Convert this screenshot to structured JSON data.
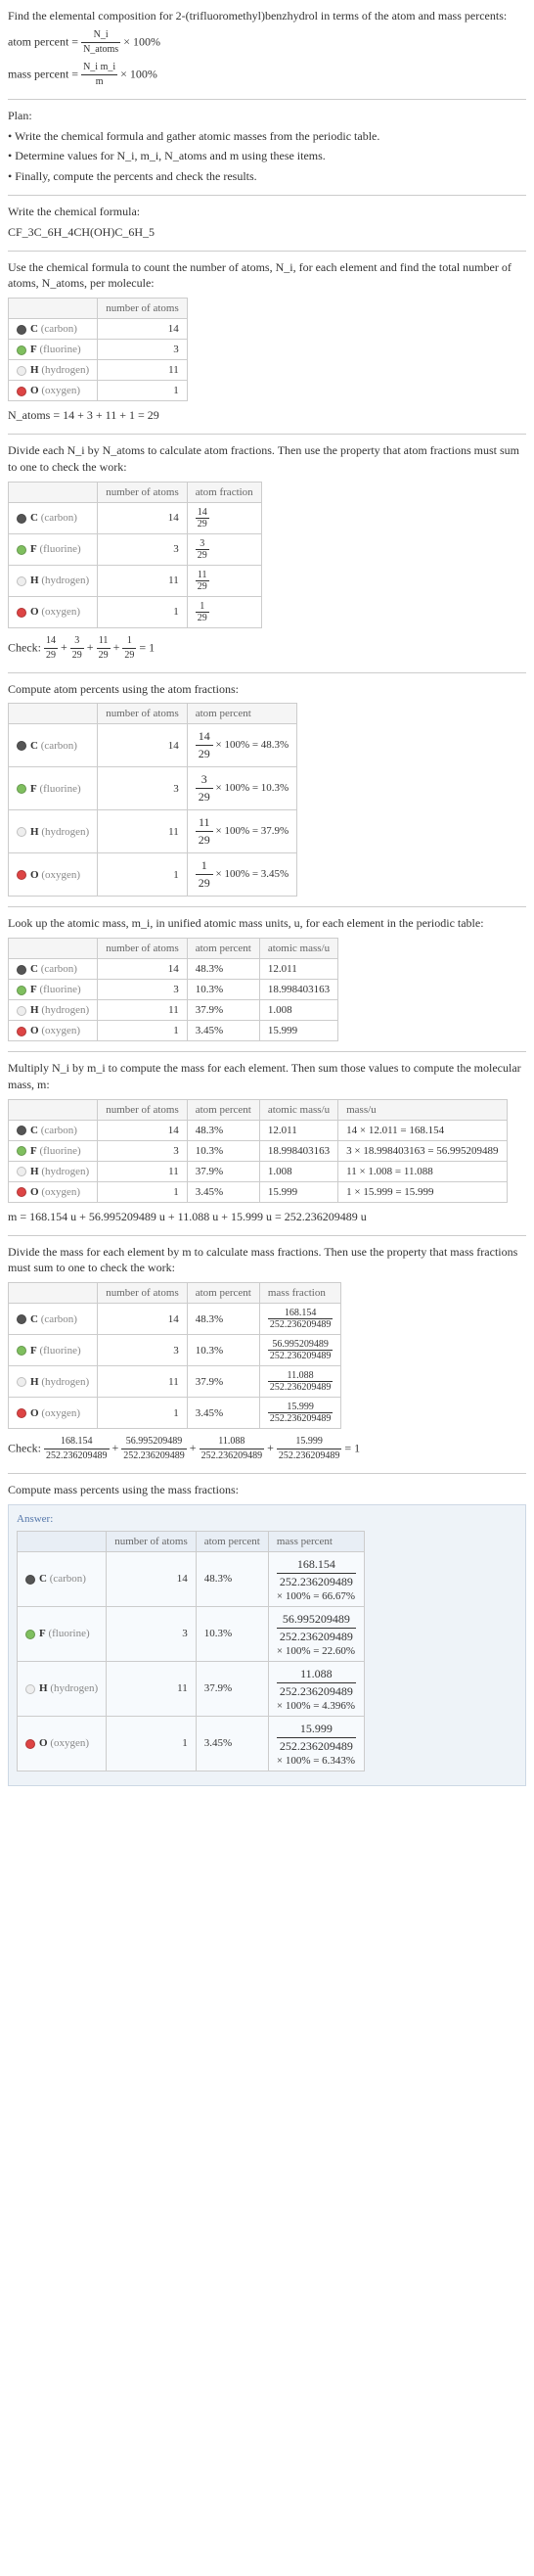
{
  "intro": {
    "line1": "Find the elemental composition for 2-(trifluoromethyl)benzhydrol in terms of the atom and mass percents:",
    "atom_eq_lhs": "atom percent =",
    "atom_eq_num": "N_i",
    "atom_eq_den": "N_atoms",
    "times100": "× 100%",
    "mass_eq_lhs": "mass percent =",
    "mass_eq_num": "N_i m_i",
    "mass_eq_den": "m"
  },
  "plan": {
    "title": "Plan:",
    "b1": "• Write the chemical formula and gather atomic masses from the periodic table.",
    "b2": "• Determine values for N_i, m_i, N_atoms and m using these items.",
    "b3": "• Finally, compute the percents and check the results."
  },
  "chem_formula": {
    "title": "Write the chemical formula:",
    "formula": "CF_3C_6H_4CH(OH)C_6H_5"
  },
  "count_atoms": {
    "title": "Use the chemical formula to count the number of atoms, N_i, for each element and find the total number of atoms, N_atoms, per molecule:",
    "headers": [
      "",
      "number of atoms"
    ],
    "rows": [
      {
        "dot": "dot-c",
        "sym": "C",
        "name": "(carbon)",
        "n": "14"
      },
      {
        "dot": "dot-f",
        "sym": "F",
        "name": "(fluorine)",
        "n": "3"
      },
      {
        "dot": "dot-h",
        "sym": "H",
        "name": "(hydrogen)",
        "n": "11"
      },
      {
        "dot": "dot-o",
        "sym": "O",
        "name": "(oxygen)",
        "n": "1"
      }
    ],
    "sum": "N_atoms = 14 + 3 + 11 + 1 = 29"
  },
  "atom_fractions": {
    "title": "Divide each N_i by N_atoms to calculate atom fractions. Then use the property that atom fractions must sum to one to check the work:",
    "headers": [
      "",
      "number of atoms",
      "atom fraction"
    ],
    "rows": [
      {
        "dot": "dot-c",
        "sym": "C",
        "name": "(carbon)",
        "n": "14",
        "fnum": "14",
        "fden": "29"
      },
      {
        "dot": "dot-f",
        "sym": "F",
        "name": "(fluorine)",
        "n": "3",
        "fnum": "3",
        "fden": "29"
      },
      {
        "dot": "dot-h",
        "sym": "H",
        "name": "(hydrogen)",
        "n": "11",
        "fnum": "11",
        "fden": "29"
      },
      {
        "dot": "dot-o",
        "sym": "O",
        "name": "(oxygen)",
        "n": "1",
        "fnum": "1",
        "fden": "29"
      }
    ],
    "check_prefix": "Check:",
    "check_eq": " + ",
    "check_eqend": " = 1"
  },
  "atom_percents": {
    "title": "Compute atom percents using the atom fractions:",
    "headers": [
      "",
      "number of atoms",
      "atom percent"
    ],
    "rows": [
      {
        "dot": "dot-c",
        "sym": "C",
        "name": "(carbon)",
        "n": "14",
        "fnum": "14",
        "fden": "29",
        "pct": "× 100% = 48.3%"
      },
      {
        "dot": "dot-f",
        "sym": "F",
        "name": "(fluorine)",
        "n": "3",
        "fnum": "3",
        "fden": "29",
        "pct": "× 100% = 10.3%"
      },
      {
        "dot": "dot-h",
        "sym": "H",
        "name": "(hydrogen)",
        "n": "11",
        "fnum": "11",
        "fden": "29",
        "pct": "× 100% = 37.9%"
      },
      {
        "dot": "dot-o",
        "sym": "O",
        "name": "(oxygen)",
        "n": "1",
        "fnum": "1",
        "fden": "29",
        "pct": "× 100% = 3.45%"
      }
    ]
  },
  "atomic_mass": {
    "title": "Look up the atomic mass, m_i, in unified atomic mass units, u, for each element in the periodic table:",
    "headers": [
      "",
      "number of atoms",
      "atom percent",
      "atomic mass/u"
    ],
    "rows": [
      {
        "dot": "dot-c",
        "sym": "C",
        "name": "(carbon)",
        "n": "14",
        "pct": "48.3%",
        "mass": "12.011"
      },
      {
        "dot": "dot-f",
        "sym": "F",
        "name": "(fluorine)",
        "n": "3",
        "pct": "10.3%",
        "mass": "18.998403163"
      },
      {
        "dot": "dot-h",
        "sym": "H",
        "name": "(hydrogen)",
        "n": "11",
        "pct": "37.9%",
        "mass": "1.008"
      },
      {
        "dot": "dot-o",
        "sym": "O",
        "name": "(oxygen)",
        "n": "1",
        "pct": "3.45%",
        "mass": "15.999"
      }
    ]
  },
  "molecular_mass": {
    "title": "Multiply N_i by m_i to compute the mass for each element. Then sum those values to compute the molecular mass, m:",
    "headers": [
      "",
      "number of atoms",
      "atom percent",
      "atomic mass/u",
      "mass/u"
    ],
    "rows": [
      {
        "dot": "dot-c",
        "sym": "C",
        "name": "(carbon)",
        "n": "14",
        "pct": "48.3%",
        "mass": "12.011",
        "calc": "14 × 12.011 = 168.154"
      },
      {
        "dot": "dot-f",
        "sym": "F",
        "name": "(fluorine)",
        "n": "3",
        "pct": "10.3%",
        "mass": "18.998403163",
        "calc": "3 × 18.998403163 = 56.995209489"
      },
      {
        "dot": "dot-h",
        "sym": "H",
        "name": "(hydrogen)",
        "n": "11",
        "pct": "37.9%",
        "mass": "1.008",
        "calc": "11 × 1.008 = 11.088"
      },
      {
        "dot": "dot-o",
        "sym": "O",
        "name": "(oxygen)",
        "n": "1",
        "pct": "3.45%",
        "mass": "15.999",
        "calc": "1 × 15.999 = 15.999"
      }
    ],
    "sum": "m = 168.154 u + 56.995209489 u + 11.088 u + 15.999 u = 252.236209489 u"
  },
  "mass_fractions": {
    "title": "Divide the mass for each element by m to calculate mass fractions. Then use the property that mass fractions must sum to one to check the work:",
    "headers": [
      "",
      "number of atoms",
      "atom percent",
      "mass fraction"
    ],
    "rows": [
      {
        "dot": "dot-c",
        "sym": "C",
        "name": "(carbon)",
        "n": "14",
        "pct": "48.3%",
        "fnum": "168.154",
        "fden": "252.236209489"
      },
      {
        "dot": "dot-f",
        "sym": "F",
        "name": "(fluorine)",
        "n": "3",
        "pct": "10.3%",
        "fnum": "56.995209489",
        "fden": "252.236209489"
      },
      {
        "dot": "dot-h",
        "sym": "H",
        "name": "(hydrogen)",
        "n": "11",
        "pct": "37.9%",
        "fnum": "11.088",
        "fden": "252.236209489"
      },
      {
        "dot": "dot-o",
        "sym": "O",
        "name": "(oxygen)",
        "n": "1",
        "pct": "3.45%",
        "fnum": "15.999",
        "fden": "252.236209489"
      }
    ],
    "check_prefix": "Check:",
    "check_nums": [
      "168.154",
      "56.995209489",
      "11.088",
      "15.999"
    ],
    "check_den": "252.236209489",
    "check_end": " = 1"
  },
  "mass_percents_title": "Compute mass percents using the mass fractions:",
  "answer": {
    "label": "Answer:",
    "headers": [
      "",
      "number of atoms",
      "atom percent",
      "mass percent"
    ],
    "rows": [
      {
        "dot": "dot-c",
        "sym": "C",
        "name": "(carbon)",
        "n": "14",
        "pct": "48.3%",
        "fnum": "168.154",
        "fden": "252.236209489",
        "res": "× 100% = 66.67%"
      },
      {
        "dot": "dot-f",
        "sym": "F",
        "name": "(fluorine)",
        "n": "3",
        "pct": "10.3%",
        "fnum": "56.995209489",
        "fden": "252.236209489",
        "res": "× 100% = 22.60%"
      },
      {
        "dot": "dot-h",
        "sym": "H",
        "name": "(hydrogen)",
        "n": "11",
        "pct": "37.9%",
        "fnum": "11.088",
        "fden": "252.236209489",
        "res": "× 100% = 4.396%"
      },
      {
        "dot": "dot-o",
        "sym": "O",
        "name": "(oxygen)",
        "n": "1",
        "pct": "3.45%",
        "fnum": "15.999",
        "fden": "252.236209489",
        "res": "× 100% = 6.343%"
      }
    ]
  }
}
